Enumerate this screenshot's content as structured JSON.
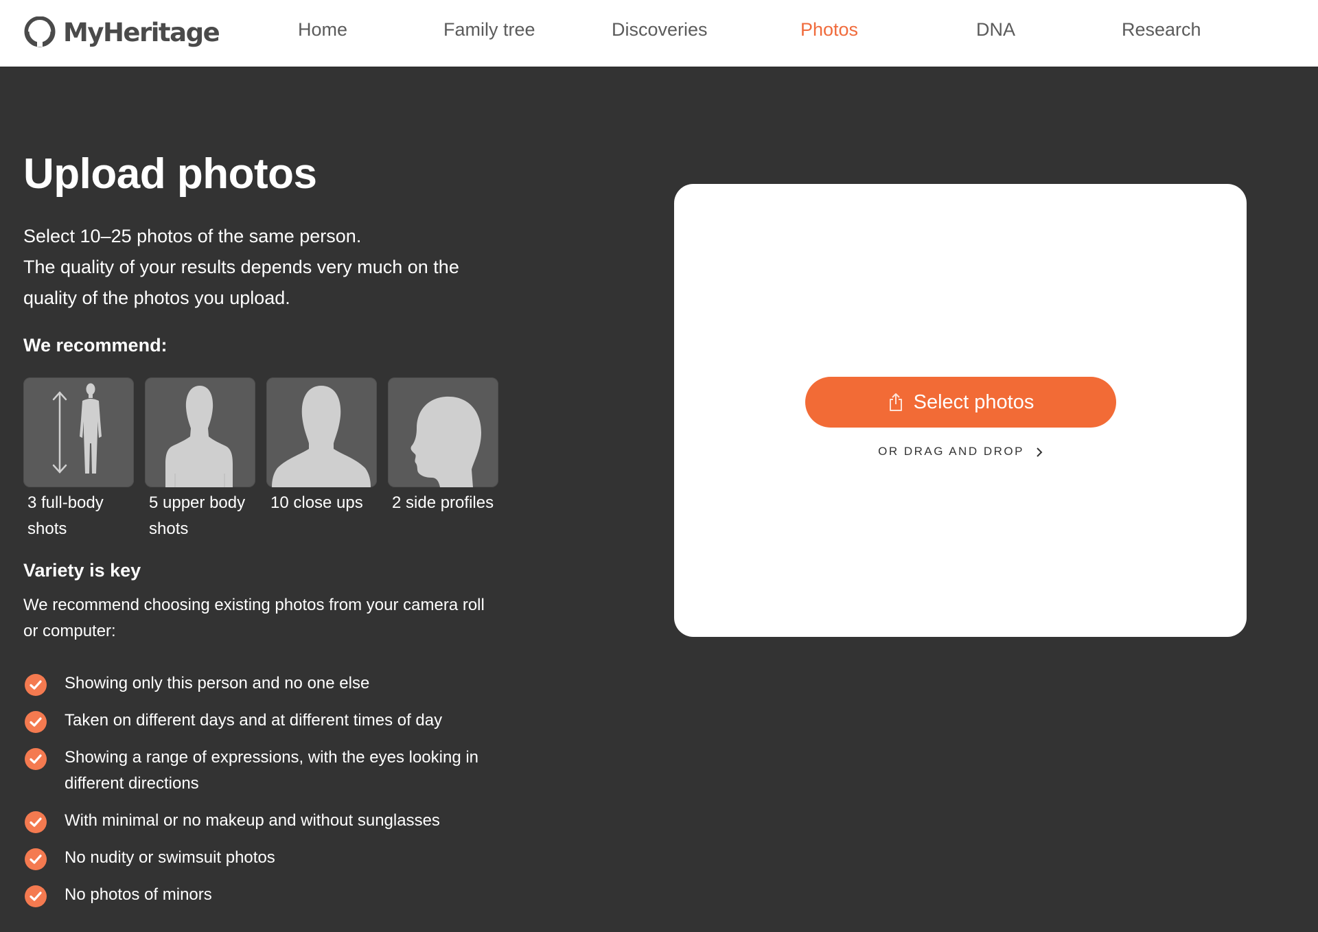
{
  "header": {
    "logo_text": "MyHeritage",
    "nav": [
      {
        "label": "Home",
        "active": false
      },
      {
        "label": "Family tree",
        "active": false
      },
      {
        "label": "Discoveries",
        "active": false
      },
      {
        "label": "Photos",
        "active": true
      },
      {
        "label": "DNA",
        "active": false
      },
      {
        "label": "Research",
        "active": false
      }
    ]
  },
  "main": {
    "title": "Upload photos",
    "intro_lines": [
      "Select 10–25 photos of the same person.",
      "The quality of your results depends very much on the",
      "quality of the photos you upload."
    ],
    "recommend_title": "We recommend:",
    "shots": [
      {
        "icon": "full-body-silhouette-icon",
        "label_line1": "3 full-body",
        "label_line2": "shots"
      },
      {
        "icon": "upper-body-silhouette-icon",
        "label_line1": "5 upper body",
        "label_line2": "shots"
      },
      {
        "icon": "close-up-silhouette-icon",
        "label_line1": "10 close ups",
        "label_line2": ""
      },
      {
        "icon": "side-profile-silhouette-icon",
        "label_line1": "2 side profiles",
        "label_line2": ""
      }
    ],
    "variety_title": "Variety is key",
    "variety_desc_lines": [
      "We recommend choosing existing photos from your camera roll",
      "or computer:"
    ],
    "checklist": [
      {
        "line1": "Showing only this person and no one else",
        "line2": ""
      },
      {
        "line1": "Taken on different days and at different times of day",
        "line2": ""
      },
      {
        "line1": "Showing a range of expressions, with the eyes looking in",
        "line2": "different directions"
      },
      {
        "line1": "With minimal or no makeup and without sunglasses",
        "line2": ""
      },
      {
        "line1": "No nudity or swimsuit photos",
        "line2": ""
      },
      {
        "line1": "No photos of minors",
        "line2": ""
      }
    ]
  },
  "upload": {
    "select_button_label": "Select photos",
    "select_button_icon": "upload-share-icon",
    "drag_drop_label": "OR DRAG AND DROP",
    "drag_drop_icon": "chevron-right-icon"
  },
  "colors": {
    "accent": "#f26b36",
    "nav_active": "#f06b3c",
    "background": "#333333",
    "check_circle": "#f47a50"
  }
}
